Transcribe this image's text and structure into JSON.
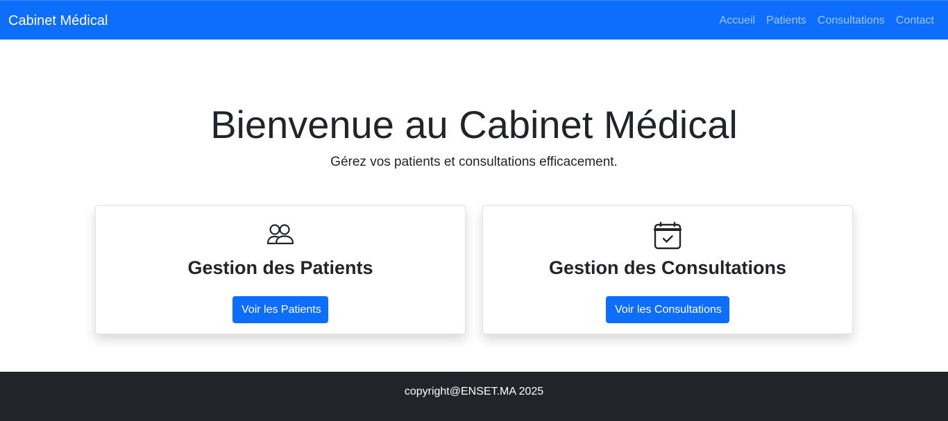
{
  "navbar": {
    "brand": "Cabinet Médical",
    "links": [
      "Accueil",
      "Patients",
      "Consultations",
      "Contact"
    ],
    "background_color": "#0d6efd"
  },
  "hero": {
    "title": "Bienvenue au Cabinet Médical",
    "subtitle": "Gérez vos patients et consultations efficacement."
  },
  "cards": [
    {
      "icon": "people-icon",
      "title": "Gestion des Patients",
      "button_label": "Voir les Patients"
    },
    {
      "icon": "calendar-check-icon",
      "title": "Gestion des Consultations",
      "button_label": "Voir les Consultations"
    }
  ],
  "footer": {
    "text": "copyright@ENSET.MA 2025",
    "background_color": "#212529"
  },
  "colors": {
    "accent": "#0d6efd",
    "nav_link": "rgba(255,255,255,0.6)",
    "text": "#212529"
  }
}
